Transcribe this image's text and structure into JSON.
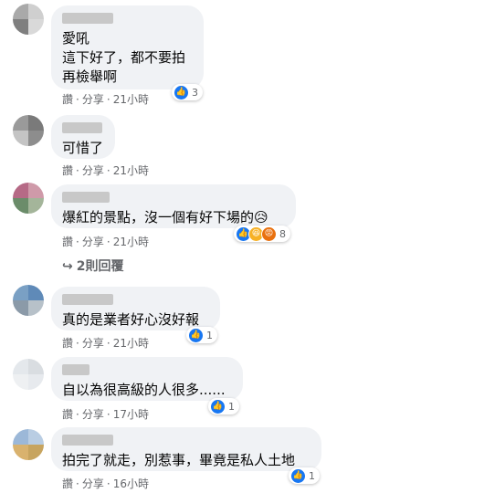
{
  "meta": {
    "like": "讚",
    "share": "分享",
    "sep": "·"
  },
  "reply_link": {
    "icon": "reply-arrow-icon",
    "label": "2則回覆"
  },
  "comments": [
    {
      "text": "愛吼\n這下好了，都不要拍\n再檢舉啊",
      "time": "21小時",
      "count": "3",
      "avatar": [
        "#a9a9a9",
        "#cfcfcf",
        "#7f7f7f",
        "#d9d9d9"
      ]
    },
    {
      "text": "可惜了",
      "time": "21小時",
      "count": "",
      "avatar": [
        "#9a9a9a",
        "#7a7a7a",
        "#c4c4c4",
        "#8d8d8d"
      ]
    },
    {
      "text": "爆紅的景點，沒一個有好下場的😥",
      "time": "21小時",
      "count": "8",
      "avatar": [
        "#b66a86",
        "#cf9aa9",
        "#6b8c6a",
        "#a4b59a"
      ]
    },
    {
      "text": "真的是業者好心沒好報",
      "time": "21小時",
      "count": "1",
      "avatar": [
        "#7aa0c4",
        "#5f8ab8",
        "#8b9aa8",
        "#b7c1c9"
      ]
    },
    {
      "text": "自以為很高級的人很多......",
      "time": "17小時",
      "count": "1",
      "avatar": [
        "#e4e8ec",
        "#d9dde1",
        "#eef0f2",
        "#e7eaee"
      ]
    },
    {
      "text": "拍完了就走，別惹事，畢竟是私人土地",
      "time": "16小時",
      "count": "1",
      "avatar": [
        "#9cb8d8",
        "#b9cde3",
        "#d9b26e",
        "#c7a45f"
      ]
    }
  ]
}
